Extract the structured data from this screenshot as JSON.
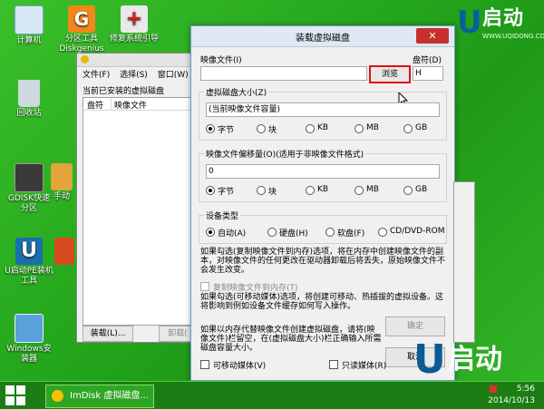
{
  "desktop": {
    "icons": [
      {
        "label": "计算机",
        "icon": "computer-icon",
        "color": "#d8e7f5"
      },
      {
        "label": "分区工具\nDiskgenius",
        "icon": "diskgenius-icon",
        "color": "#f0891a"
      },
      {
        "label": "修复系统引导",
        "icon": "repair-kit-icon",
        "color": "#e9e9e9"
      },
      {
        "label": "回收站",
        "icon": "recycle-bin-icon",
        "color": "#cfd7df"
      },
      {
        "label": "GDISK快速分区",
        "icon": "gdisk-icon",
        "color": "#3a3a3a"
      },
      {
        "label": "手动",
        "icon": "manual-tool-icon",
        "color": "#e0a43a"
      },
      {
        "label": "U启动PE装机工具",
        "icon": "uqidong-pe-icon",
        "color": "#1c6fae"
      },
      {
        "label": "",
        "icon": "app-icon",
        "color": "#d74a1f"
      },
      {
        "label": "Windows安装器",
        "icon": "windows-installer-icon",
        "color": "#5aa0d9"
      }
    ]
  },
  "logo": {
    "u": "U",
    "text": "启动",
    "site": "WWW.UQIDONG.COM"
  },
  "watermark": {
    "u": "U",
    "text": "启动"
  },
  "back_window": {
    "menu": [
      "文件(F)",
      "选择(S)",
      "窗口(W)"
    ],
    "heading": "当前已安装的虚拟磁盘",
    "columns": [
      "盘符",
      "映像文件"
    ],
    "mount_button": "装载(L)...",
    "unmount_button": "卸载("
  },
  "dialog": {
    "title": "装载虚拟磁盘",
    "close_label": "✕",
    "image_file_label": "映像文件(I)",
    "image_file_value": "",
    "browse_button": "浏览",
    "drive_label": "盘符(D)",
    "drive_value": "H",
    "size_group": "虚拟磁盘大小(Z)",
    "size_value": "(当前映像文件容量)",
    "size_units": [
      "字节",
      "块",
      "KB",
      "MB",
      "GB"
    ],
    "size_unit_selected": "字节",
    "offset_group": "映像文件偏移量(O)(适用于非映像文件格式)",
    "offset_value": "0",
    "offset_units": [
      "字节",
      "块",
      "KB",
      "MB",
      "GB"
    ],
    "device_group": "设备类型",
    "device_types": [
      "自动(A)",
      "硬盘(H)",
      "软盘(F)",
      "CD/DVD-ROM"
    ],
    "device_selected": "自动(A)",
    "note1": "如果勾选(复制映像文件到内存)选项，将在内存中创建映像文件的副本，对映像文件的任何更改在驱动器卸载后将丢失，原始映像文件不会发生改变。",
    "copy_to_memory": "复制映像文件到内存(T)",
    "note2": "如果勾选(可移动媒体)选项，将创建可移动、热插拔的虚拟设备。这将影响到例如设备文件缓存如何写入操作。",
    "note3": "如果以内存代替映像文件创建虚拟磁盘，请将(映像文件)栏留空，在(虚拟磁盘大小)栏正确输入所需磁盘容量大小。",
    "ok_button": "确定",
    "cancel_button": "取消",
    "removable_label": "可移动媒体(V)",
    "readonly_label": "只读媒体(R)"
  },
  "taskbar": {
    "task_label": "ImDisk 虚拟磁盘...",
    "time": "5:56",
    "date": "2014/10/13"
  },
  "colors": {
    "desktop": "#2aae20",
    "close_button": "#c7302a",
    "highlight_box": "#e01010"
  }
}
